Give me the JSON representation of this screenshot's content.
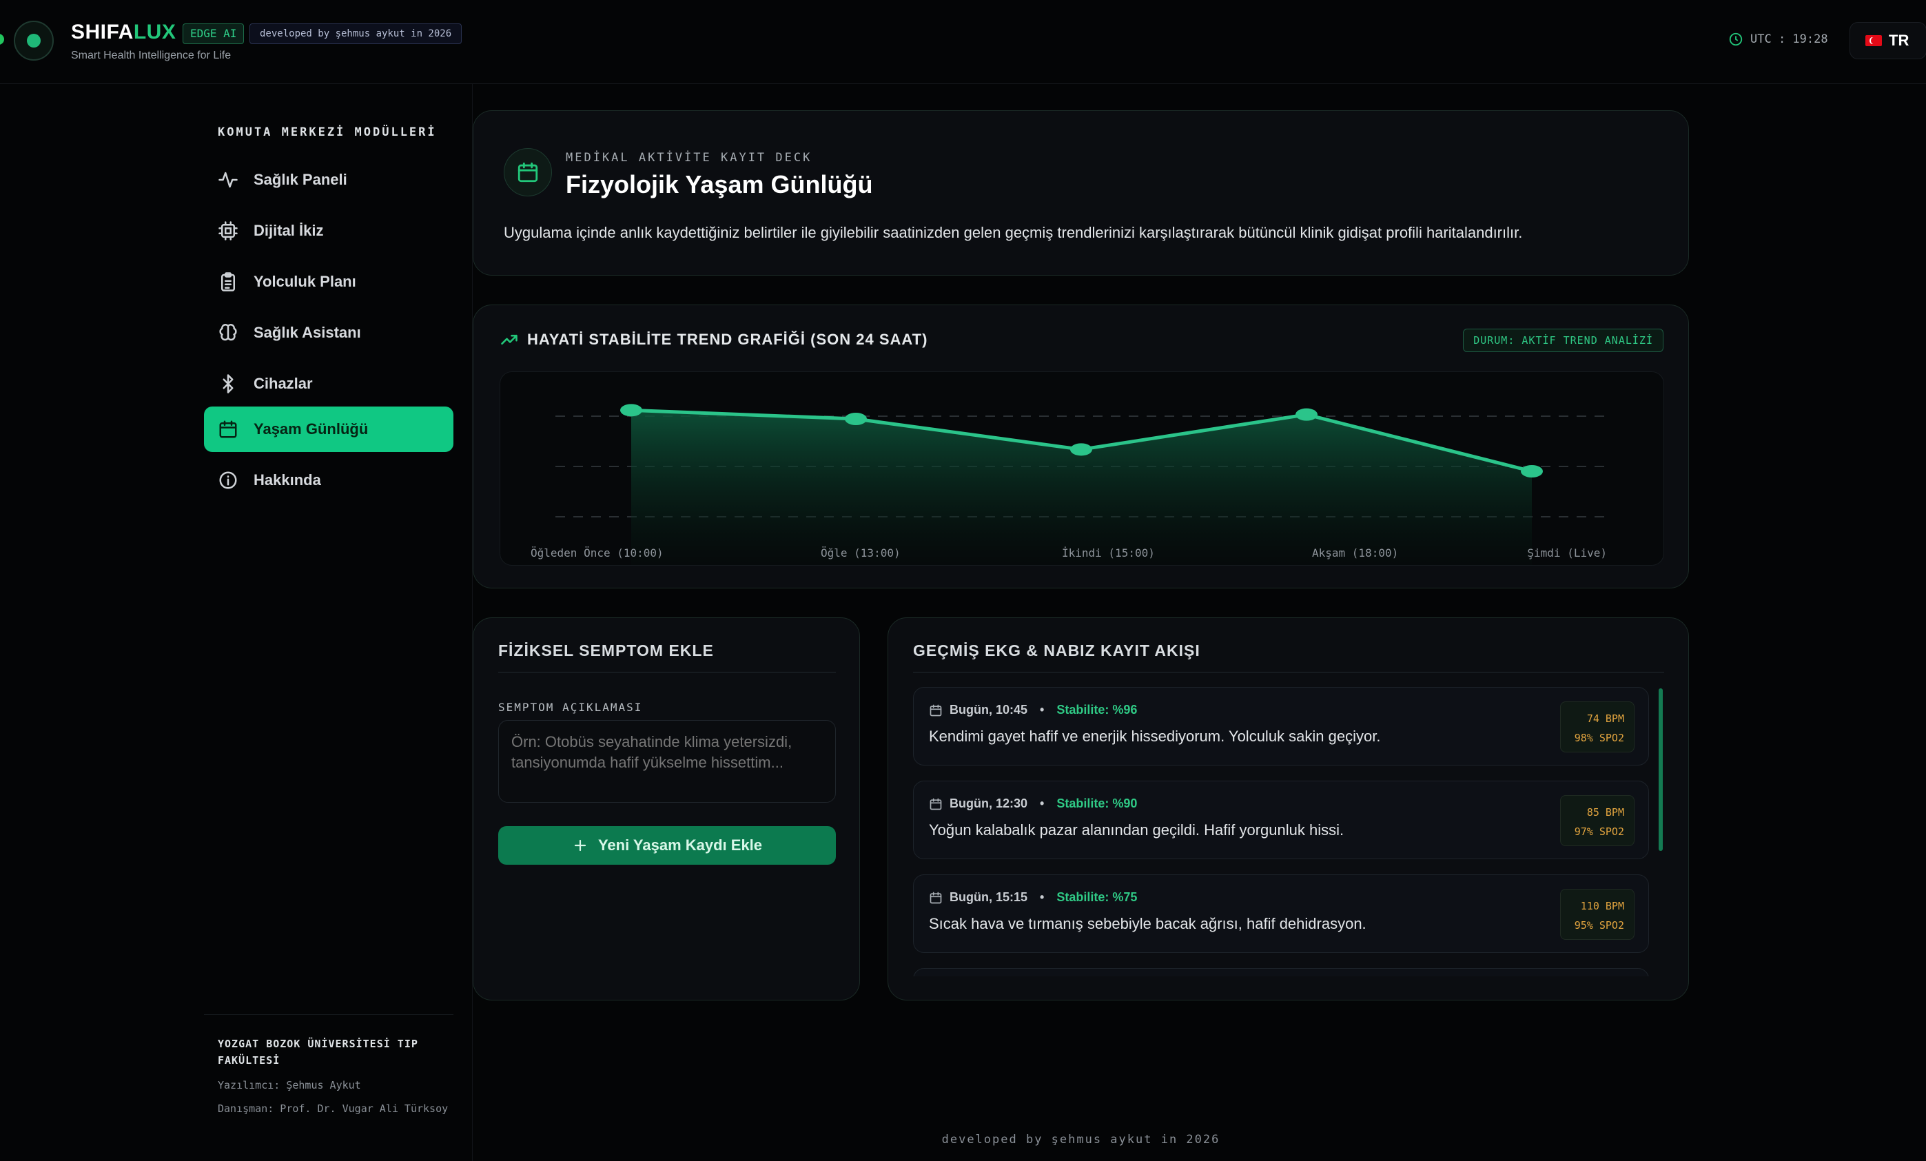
{
  "header": {
    "brand_main": "SHIFA",
    "brand_accent": "LUX",
    "edge_badge": "EDGE AI",
    "developer_badge": "developed by şehmus aykut in 2026",
    "subtitle": "Smart Health Intelligence for Life",
    "clock": "UTC : 19:28",
    "language": "TR"
  },
  "sidebar": {
    "title": "KOMUTA MERKEZİ MODÜLLERİ",
    "items": [
      {
        "label": "Sağlık Paneli",
        "icon": "activity-icon"
      },
      {
        "label": "Dijital İkiz",
        "icon": "cpu-icon"
      },
      {
        "label": "Yolculuk Planı",
        "icon": "clipboard-icon"
      },
      {
        "label": "Sağlık Asistanı",
        "icon": "brain-icon"
      },
      {
        "label": "Cihazlar",
        "icon": "bluetooth-icon"
      },
      {
        "label": "Yaşam Günlüğü",
        "icon": "calendar-icon",
        "active": true
      },
      {
        "label": "Hakkında",
        "icon": "info-icon"
      }
    ],
    "footer": {
      "institution": "YOZGAT BOZOK ÜNİVERSİTESİ TIP FAKÜLTESİ",
      "developer": "Yazılımcı: Şehmus Aykut",
      "advisor": "Danışman: Prof. Dr. Vugar Ali Türksoy"
    }
  },
  "hero": {
    "kicker": "MEDİKAL AKTİVİTE KAYIT DECK",
    "title": "Fizyolojik Yaşam Günlüğü",
    "description": "Uygulama içinde anlık kaydettiğiniz belirtiler ile giyilebilir saatinizden gelen geçmiş trendlerinizi karşılaştırarak bütüncül klinik gidişat profili haritalandırılır."
  },
  "trend": {
    "title": "HAYATİ STABİLİTE TREND GRAFİĞİ (SON 24 SAAT)",
    "status": "DURUM: AKTİF TREND ANALİZİ"
  },
  "chart_data": {
    "type": "area",
    "categories": [
      "Öğleden Önce (10:00)",
      "Öğle (13:00)",
      "İkindi (15:00)",
      "Akşam (18:00)",
      "Şimdi (Live)"
    ],
    "values": [
      96,
      94,
      87,
      95,
      82
    ],
    "ylim": [
      70,
      100
    ],
    "grid": true,
    "colors": {
      "line": "#2bc48a",
      "fill": "#0e5a3e"
    }
  },
  "symptom": {
    "title": "FİZİKSEL SEMPTOM EKLE",
    "field_label": "SEMPTOM AÇIKLAMASI",
    "placeholder": "Örn: Otobüs seyahatinde klima yetersizdi, tansiyonumda hafif yükselme hissettim...",
    "button_label": "Yeni Yaşam Kaydı Ekle"
  },
  "log": {
    "title": "GEÇMİŞ EKG & NABIZ KAYIT AKIŞI",
    "entries": [
      {
        "time": "Bugün, 10:45",
        "stability": "Stabilite: %96",
        "text": "Kendimi gayet hafif ve enerjik hissediyorum. Yolculuk sakin geçiyor.",
        "bpm": "74 BPM",
        "spo2": "98% SPO2"
      },
      {
        "time": "Bugün, 12:30",
        "stability": "Stabilite: %90",
        "text": "Yoğun kalabalık pazar alanından geçildi. Hafif yorgunluk hissi.",
        "bpm": "85 BPM",
        "spo2": "97% SPO2"
      },
      {
        "time": "Bugün, 15:15",
        "stability": "Stabilite: %75",
        "text": "Sıcak hava ve tırmanış sebebiyle bacak ağrısı, hafif dehidrasyon.",
        "bpm": "110 BPM",
        "spo2": "95% SPO2"
      }
    ]
  },
  "footer": {
    "credit": "developed by şehmus aykut in 2026"
  }
}
